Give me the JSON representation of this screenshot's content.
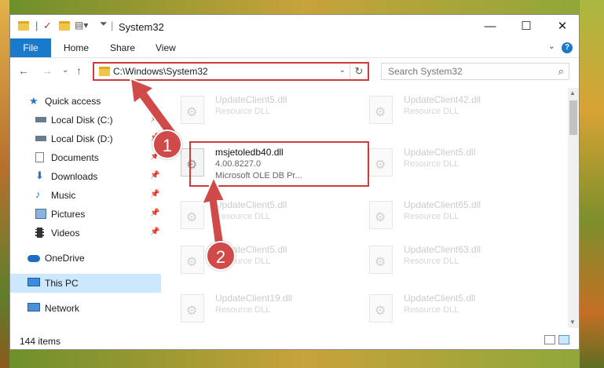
{
  "window": {
    "title": "System32",
    "controls": {
      "minimize": "—",
      "maximize": "☐",
      "close": "✕"
    }
  },
  "ribbon": {
    "tabs": [
      "File",
      "Home",
      "Share",
      "View"
    ],
    "help": "?"
  },
  "navigation": {
    "address": "C:\\Windows\\System32",
    "search_placeholder": "Search System32"
  },
  "sidebar": {
    "items": [
      {
        "label": "Quick access",
        "icon": "star-icon"
      },
      {
        "label": "Local Disk (C:)",
        "icon": "drive-icon"
      },
      {
        "label": "Local Disk (D:)",
        "icon": "drive-icon"
      },
      {
        "label": "Documents",
        "icon": "documents-icon"
      },
      {
        "label": "Downloads",
        "icon": "download-icon"
      },
      {
        "label": "Music",
        "icon": "music-icon"
      },
      {
        "label": "Pictures",
        "icon": "pictures-icon"
      },
      {
        "label": "Videos",
        "icon": "videos-icon"
      },
      {
        "label": "OneDrive",
        "icon": "cloud-icon"
      },
      {
        "label": "This PC",
        "icon": "computer-icon",
        "selected": true
      },
      {
        "label": "Network",
        "icon": "network-icon"
      }
    ]
  },
  "files": [
    {
      "name": "UpdateClient5.dll",
      "type": "Resource DLL"
    },
    {
      "name": "UpdateClient42.dll",
      "type": "Resource DLL"
    },
    {
      "name": "msjetoledb40.dll",
      "version": "4.00.8227.0",
      "description": "Microsoft OLE DB Pr...",
      "highlighted": true
    },
    {
      "name": "UpdateClient5.dll",
      "type": "Resource DLL"
    },
    {
      "name": "UpdateClient5.dll",
      "type": "Resource DLL"
    },
    {
      "name": "UpdateClient65.dll",
      "type": "Resource DLL"
    },
    {
      "name": "UpdateClient5.dll",
      "type": "Resource DLL"
    },
    {
      "name": "UpdateClient63.dll",
      "type": "Resource DLL"
    },
    {
      "name": "UpdateClient19.dll",
      "type": "Resource DLL"
    },
    {
      "name": "UpdateClient5.dll",
      "type": "Resource DLL"
    }
  ],
  "status": {
    "item_count": "144 items"
  },
  "annotations": {
    "step1": "1",
    "step2": "2"
  },
  "colors": {
    "accent": "#1979ca",
    "highlight": "#cf3b3b",
    "selected": "#cce8ff"
  }
}
